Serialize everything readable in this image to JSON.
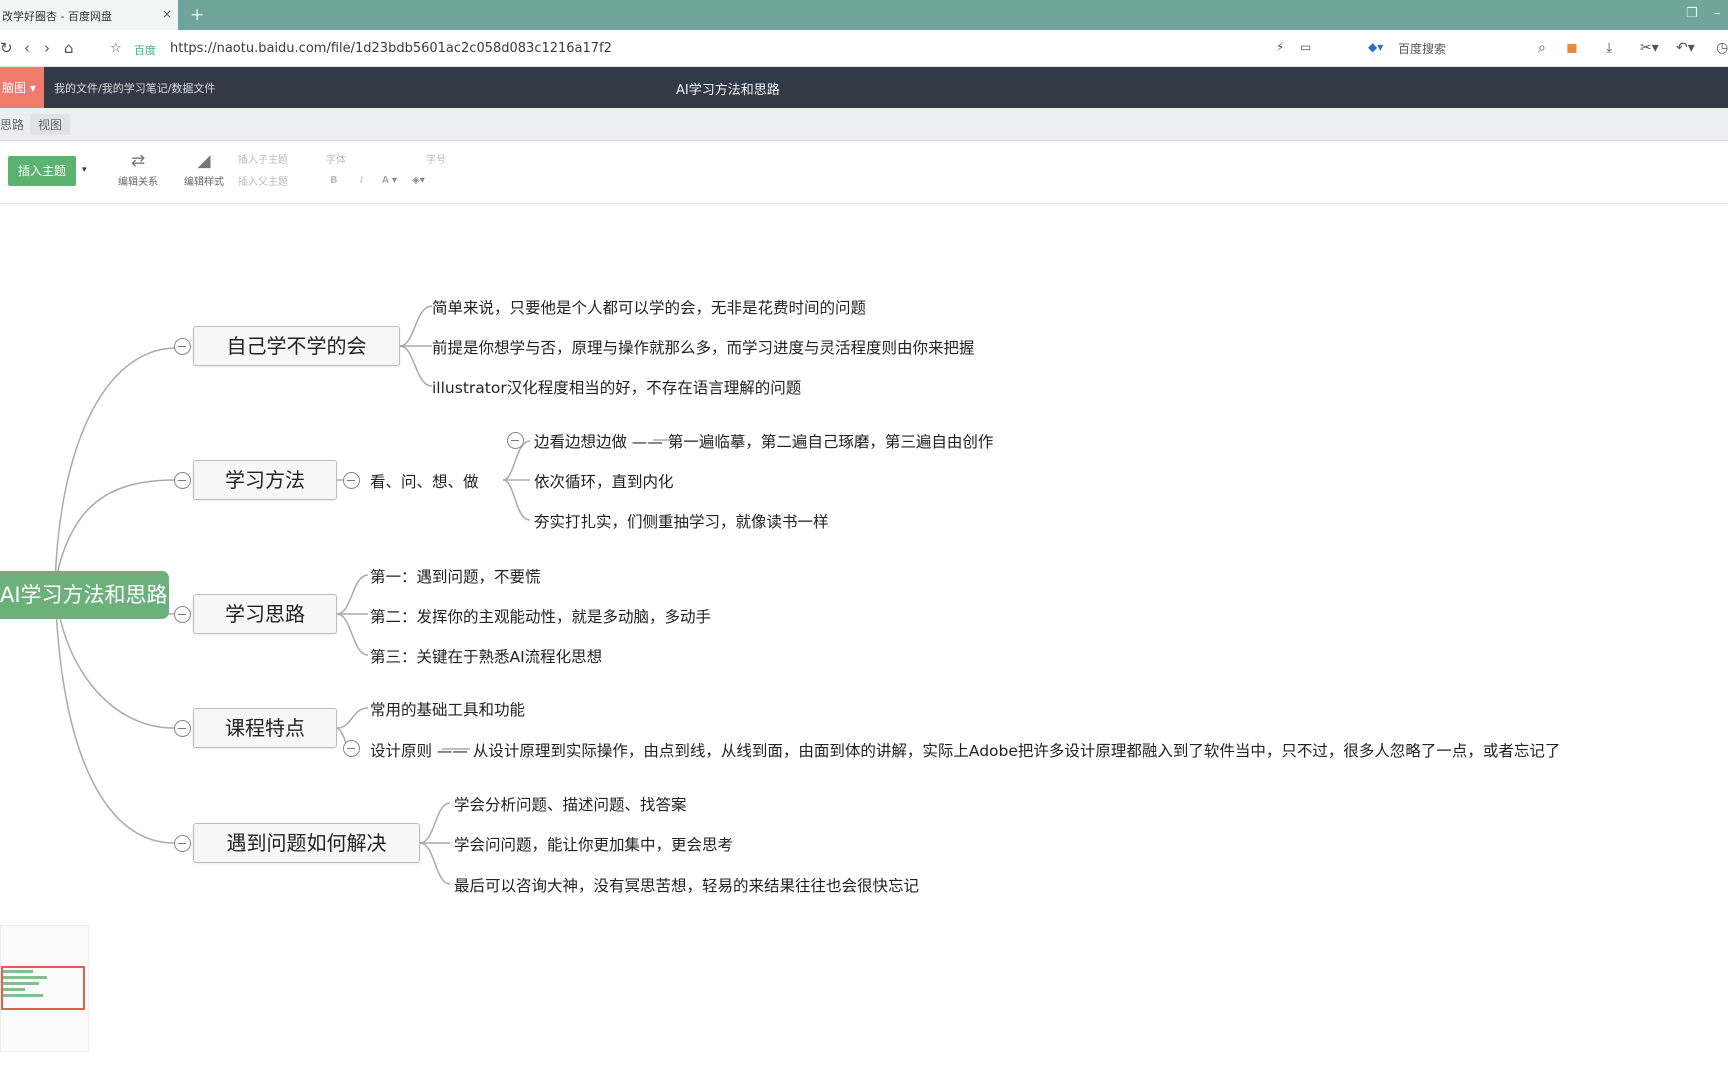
{
  "browser": {
    "tab_title": "改学好圈杏 - 百度网盘",
    "tab_close": "×",
    "new_tab": "+",
    "url": "https://naotu.baidu.com/file/1d23bdb5601ac2c058d083c1216a17f2",
    "secure_label": "百度",
    "search_hint": "百度搜索",
    "nav": {
      "back": "‹",
      "forward": "›",
      "refresh": "↻",
      "home": "⌂"
    }
  },
  "app": {
    "badge": "脑图 ▾",
    "breadcrumb": "我的文件/我的学习笔记/数据文件",
    "title": "AI学习方法和思路"
  },
  "menu": {
    "items": [
      "思路",
      "视图"
    ]
  },
  "toolbar": {
    "insert_label": "插入主题",
    "tools": [
      {
        "label": "编辑关系"
      },
      {
        "label": "编辑样式"
      }
    ],
    "small": {
      "text1": "插入子主题",
      "text2": "插入父主题",
      "font": "字体",
      "size": "字号",
      "bold": "B",
      "italic": "I",
      "color": "A ▾"
    }
  },
  "mindmap": {
    "root": "AI学习方法和思路",
    "topics": [
      {
        "label": "自己学不学的会",
        "leaves": [
          "简单来说，只要他是个人都可以学的会，无非是花费时间的问题",
          "前提是你想学与否，原理与操作就那么多，而学习进度与灵活程度则由你来把握",
          "illustrator汉化程度相当的好，不存在语言理解的问题"
        ]
      },
      {
        "label": "学习方法",
        "sub": "看、问、想、做",
        "leaves": [
          "边看边想边做 —— 第一遍临摹，第二遍自己琢磨，第三遍自由创作",
          "依次循环，直到内化",
          "夯实打扎实，们侧重抽学习，就像读书一样"
        ]
      },
      {
        "label": "学习思路",
        "leaves": [
          "第一：遇到问题，不要慌",
          "第二：发挥你的主观能动性，就是多动脑，多动手",
          "第三：关键在于熟悉AI流程化思想"
        ]
      },
      {
        "label": "课程特点",
        "leaves": [
          "常用的基础工具和功能",
          "设计原则 —— 从设计原理到实际操作，由点到线，从线到面，由面到体的讲解，实际上Adobe把许多设计原理都融入到了软件当中，只不过，很多人忽略了一点，或者忘记了"
        ]
      },
      {
        "label": "遇到问题如何解决",
        "leaves": [
          "学会分析问题、描述问题、找答案",
          "学会问问题，能让你更加集中，更会思考",
          "最后可以咨询大神，没有冥思苦想，轻易的来结果往往也会很快忘记"
        ]
      }
    ]
  }
}
